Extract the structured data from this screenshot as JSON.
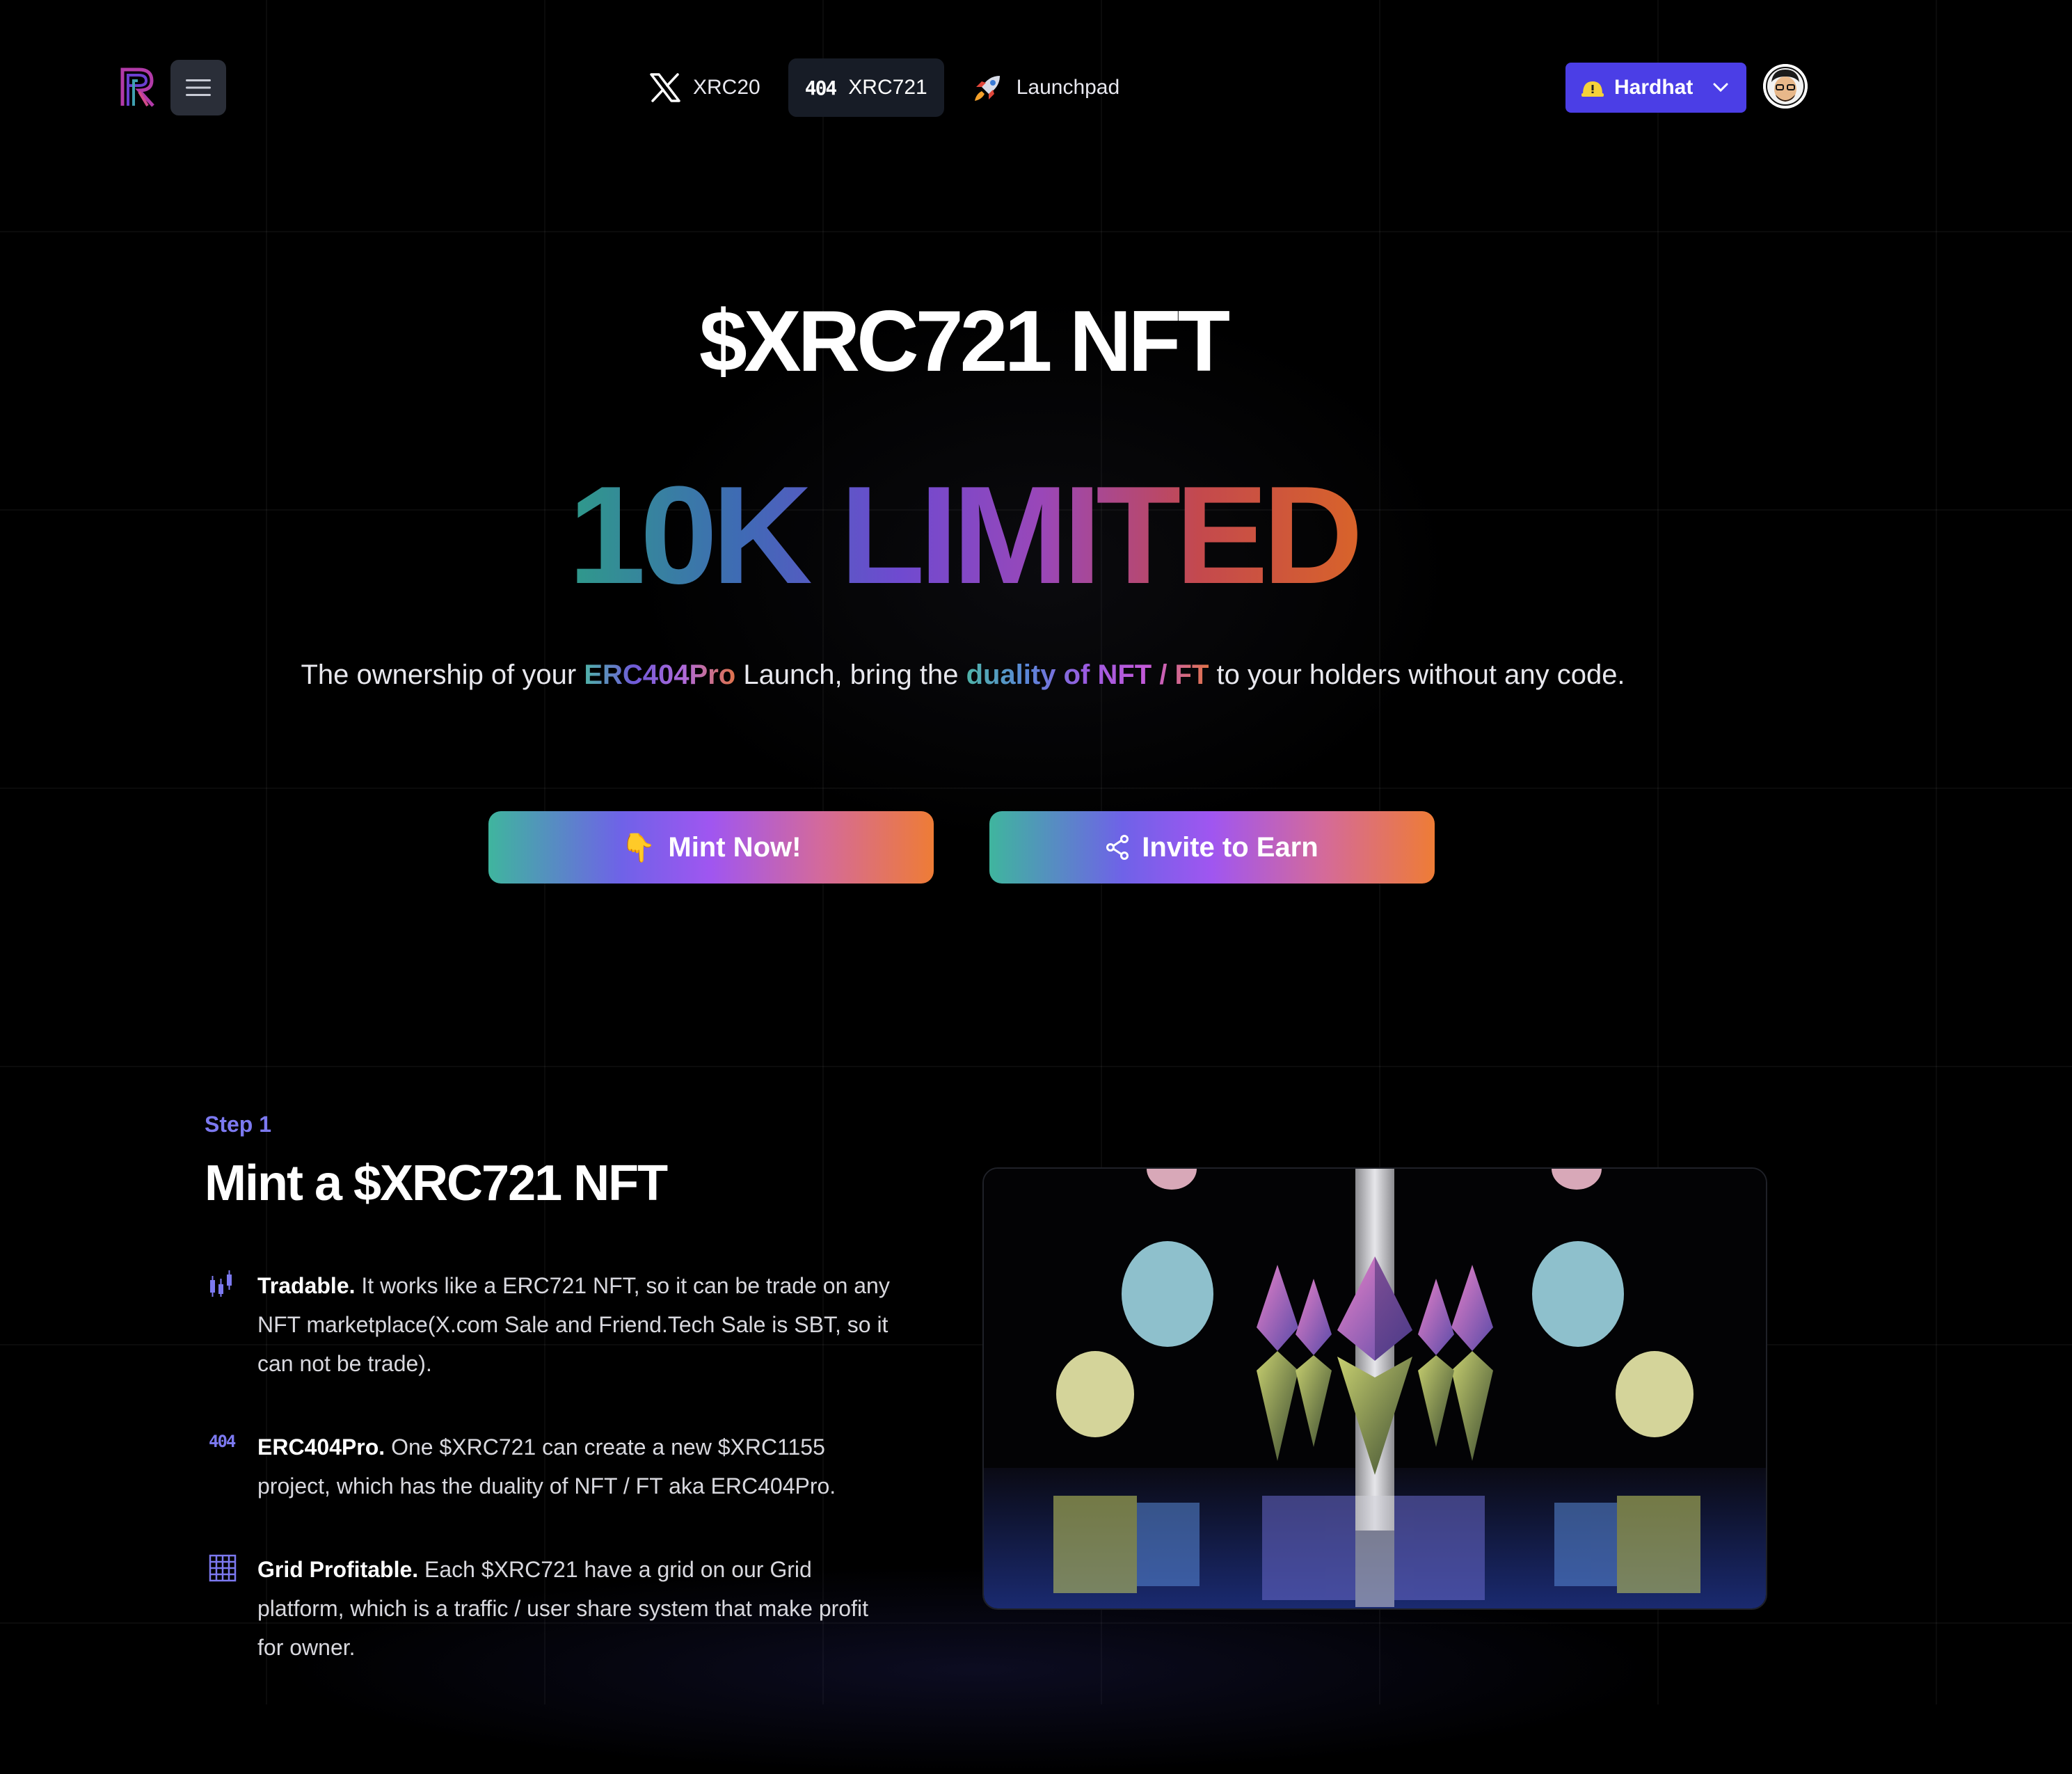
{
  "header": {
    "nav": [
      {
        "label": "XRC20",
        "icon": "x-logo-icon"
      },
      {
        "label": "XRC721",
        "badge": "404",
        "active": true
      },
      {
        "label": "Launchpad",
        "icon": "rocket-icon"
      }
    ],
    "network": {
      "label": "Hardhat",
      "icon": "hardhat-warning-icon"
    },
    "avatar": "avatar"
  },
  "hero": {
    "title": "$XRC721 NFT",
    "headline": "10K LIMITED",
    "tagline": {
      "part1": "The ownership of your ",
      "highlight1": "ERC404Pro",
      "part2": " Launch, bring the ",
      "highlight2": "duality of NFT / FT",
      "part3": " to your holders without any code."
    },
    "buttons": {
      "mint": {
        "label": "Mint Now!",
        "icon": "👇"
      },
      "invite": {
        "label": "Invite to Earn",
        "icon": "share-icon"
      }
    }
  },
  "step": {
    "label": "Step 1",
    "title": "Mint a $XRC721 NFT",
    "features": [
      {
        "icon": "candlestick-chart-icon",
        "title": "Tradable.",
        "text": " It works like a ERC721 NFT, so it can be trade on any NFT marketplace(X.com Sale and Friend.Tech Sale is SBT, so it can not be trade)."
      },
      {
        "icon": "404-icon",
        "icon_text": "404",
        "title": "ERC404Pro.",
        "text": " One $XRC721 can create a new $XRC1155 project, which has the duality of NFT / FT aka ERC404Pro."
      },
      {
        "icon": "grid-icon",
        "title": "Grid Profitable.",
        "text": " Each $XRC721 have a grid on our Grid platform, which is a traffic / user share system that make profit for owner."
      }
    ]
  },
  "colors": {
    "background": "#000000",
    "hardhat_button": "#4b3ee6",
    "step_label": "#7c79f0",
    "gradient_start": "#3fb59e",
    "gradient_mid": "#a056f0",
    "gradient_end": "#ee7c36"
  }
}
